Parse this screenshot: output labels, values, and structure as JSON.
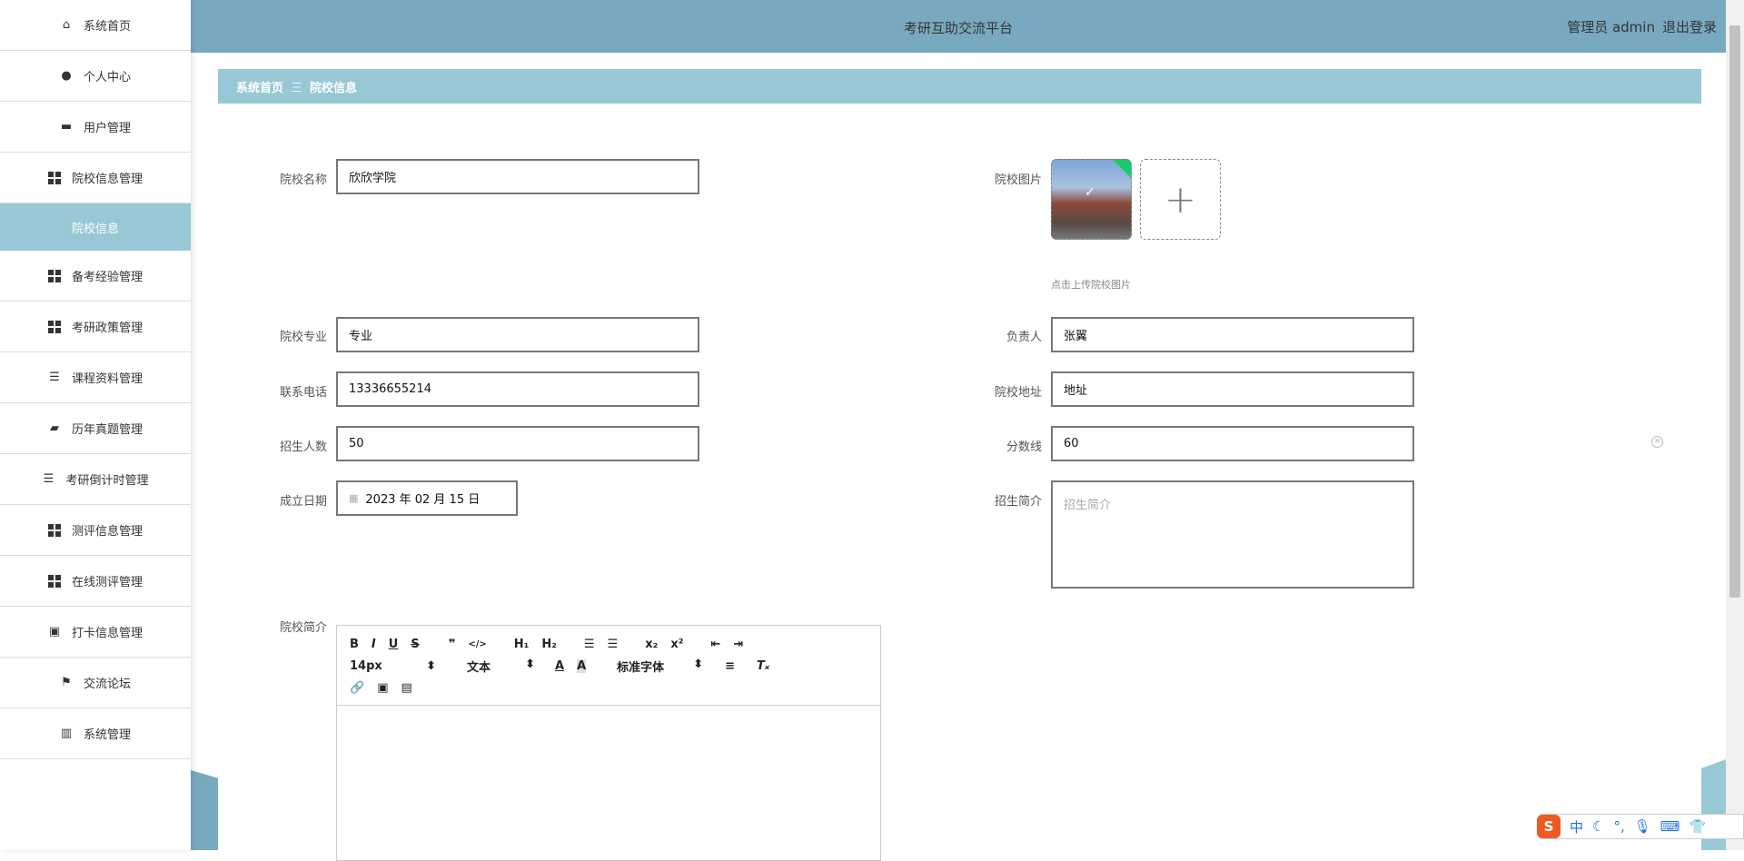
{
  "sidebar": {
    "items": [
      {
        "label": "系统首页",
        "icon": "home-icon"
      },
      {
        "label": "个人中心",
        "icon": "user-icon"
      },
      {
        "label": "用户管理",
        "icon": "users-icon"
      },
      {
        "label": "院校信息管理",
        "icon": "grid-icon"
      },
      {
        "label": "院校信息",
        "icon": ""
      },
      {
        "label": "备考经验管理",
        "icon": "grid-icon"
      },
      {
        "label": "考研政策管理",
        "icon": "grid-icon"
      },
      {
        "label": "课程资料管理",
        "icon": "list-icon"
      },
      {
        "label": "历年真题管理",
        "icon": "wallet-icon"
      },
      {
        "label": "考研倒计时管理",
        "icon": "indent-icon"
      },
      {
        "label": "测评信息管理",
        "icon": "grid-icon"
      },
      {
        "label": "在线测评管理",
        "icon": "grid-icon"
      },
      {
        "label": "打卡信息管理",
        "icon": "clipboard-icon"
      },
      {
        "label": "交流论坛",
        "icon": "flag-icon"
      },
      {
        "label": "系统管理",
        "icon": "book-icon"
      }
    ]
  },
  "header": {
    "title": "考研互助交流平台",
    "user": "管理员 admin",
    "logout": "退出登录"
  },
  "breadcrumb": {
    "home": "系统首页",
    "sep": "三",
    "current": "院校信息"
  },
  "form": {
    "name_label": "院校名称",
    "name": "欣欣学院",
    "image_label": "院校图片",
    "image_hint": "点击上传院校图片",
    "major_label": "院校专业",
    "major": "专业",
    "head_label": "负责人",
    "head": "张翼",
    "phone_label": "联系电话",
    "phone": "13336655214",
    "address_label": "院校地址",
    "address": "地址",
    "enroll_label": "招生人数",
    "enroll": "50",
    "score_label": "分数线",
    "score": "60",
    "date_label": "成立日期",
    "date": "2023 年 02 月 15 日",
    "intro_label": "招生简介",
    "intro_placeholder": "招生简介",
    "desc_label": "院校简介"
  },
  "editor": {
    "font_size": "14px",
    "block": "文本",
    "font": "标准字体"
  },
  "ime": {
    "lang": "中"
  },
  "colors": {
    "header": "#79a9bf",
    "accent": "#98c8d6"
  }
}
